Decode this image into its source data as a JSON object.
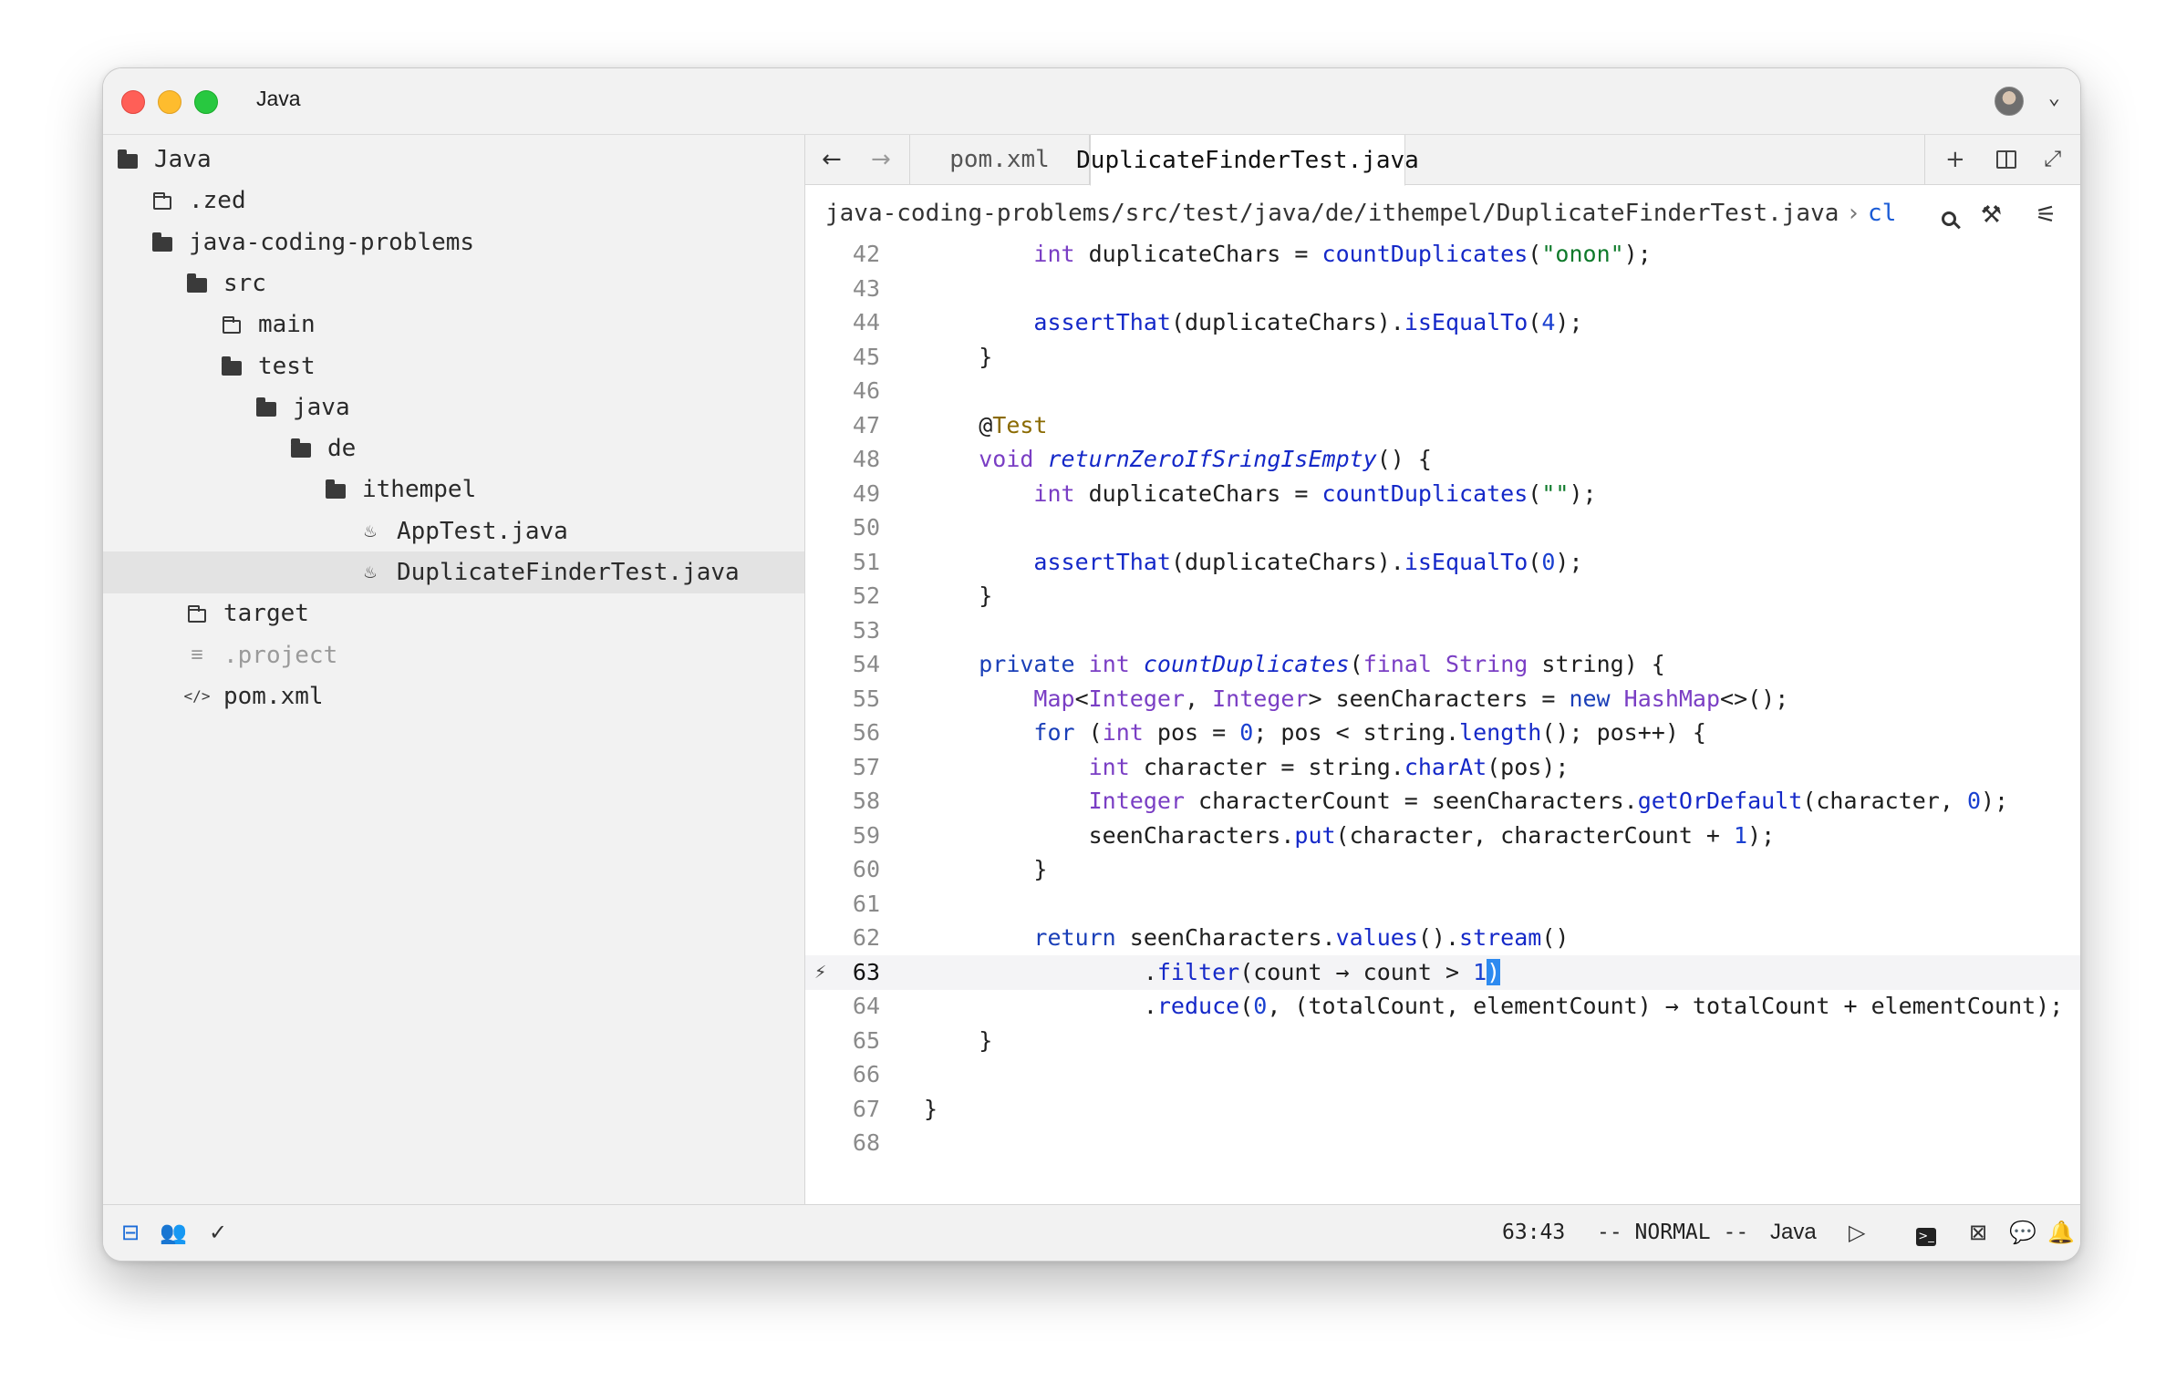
{
  "window": {
    "title": "Java"
  },
  "sidebar": {
    "items": [
      {
        "label": "Java",
        "icon": "folder-open-icon",
        "indent": 0
      },
      {
        "label": ".zed",
        "icon": "folder-icon",
        "indent": 1
      },
      {
        "label": "java-coding-problems",
        "icon": "folder-open-icon",
        "indent": 1
      },
      {
        "label": "src",
        "icon": "folder-open-icon",
        "indent": 2
      },
      {
        "label": "main",
        "icon": "folder-icon",
        "indent": 3
      },
      {
        "label": "test",
        "icon": "folder-open-icon",
        "indent": 3
      },
      {
        "label": "java",
        "icon": "folder-open-icon",
        "indent": 4
      },
      {
        "label": "de",
        "icon": "folder-open-icon",
        "indent": 5
      },
      {
        "label": "ithempel",
        "icon": "folder-open-icon",
        "indent": 6
      },
      {
        "label": "AppTest.java",
        "icon": "java-file-icon",
        "indent": 7
      },
      {
        "label": "DuplicateFinderTest.java",
        "icon": "java-file-icon",
        "indent": 7,
        "selected": true
      },
      {
        "label": "target",
        "icon": "folder-icon",
        "indent": 2
      },
      {
        "label": ".project",
        "icon": "text-file-icon",
        "indent": 2,
        "dim": true
      },
      {
        "label": "pom.xml",
        "icon": "code-file-icon",
        "indent": 2
      }
    ]
  },
  "tabs": [
    {
      "label": "pom.xml",
      "active": false
    },
    {
      "label": "DuplicateFinderTest.java",
      "active": true
    }
  ],
  "breadcrumb": {
    "path": "java-coding-problems/src/test/java/de/ithempel/DuplicateFinderTest.java",
    "separator": "›",
    "symbol": "cl"
  },
  "editor": {
    "lines": [
      {
        "n": "42",
        "tokens": [
          [
            "        ",
            ""
          ],
          [
            "int",
            "kw"
          ],
          [
            " duplicateChars = ",
            ""
          ],
          [
            "countDuplicates",
            "fn"
          ],
          [
            "(",
            ""
          ],
          [
            "\"onon\"",
            "str"
          ],
          [
            ");",
            ""
          ]
        ]
      },
      {
        "n": "43",
        "tokens": []
      },
      {
        "n": "44",
        "tokens": [
          [
            "        ",
            ""
          ],
          [
            "assertThat",
            "fn"
          ],
          [
            "(duplicateChars).",
            ""
          ],
          [
            "isEqualTo",
            "fn"
          ],
          [
            "(",
            ""
          ],
          [
            "4",
            "num"
          ],
          [
            ");",
            ""
          ]
        ]
      },
      {
        "n": "45",
        "tokens": [
          [
            "    }",
            ""
          ]
        ]
      },
      {
        "n": "46",
        "tokens": []
      },
      {
        "n": "47",
        "tokens": [
          [
            "    @",
            ""
          ],
          [
            "Test",
            "ann"
          ]
        ]
      },
      {
        "n": "48",
        "tokens": [
          [
            "    ",
            ""
          ],
          [
            "void",
            "kw"
          ],
          [
            " ",
            ""
          ],
          [
            "returnZeroIfSringIsEmpty",
            "fni"
          ],
          [
            "() {",
            ""
          ]
        ]
      },
      {
        "n": "49",
        "tokens": [
          [
            "        ",
            ""
          ],
          [
            "int",
            "kw"
          ],
          [
            " duplicateChars = ",
            ""
          ],
          [
            "countDuplicates",
            "fn"
          ],
          [
            "(",
            ""
          ],
          [
            "\"\"",
            "str"
          ],
          [
            ");",
            ""
          ]
        ]
      },
      {
        "n": "50",
        "tokens": []
      },
      {
        "n": "51",
        "tokens": [
          [
            "        ",
            ""
          ],
          [
            "assertThat",
            "fn"
          ],
          [
            "(duplicateChars).",
            ""
          ],
          [
            "isEqualTo",
            "fn"
          ],
          [
            "(",
            ""
          ],
          [
            "0",
            "num"
          ],
          [
            ");",
            ""
          ]
        ]
      },
      {
        "n": "52",
        "tokens": [
          [
            "    }",
            ""
          ]
        ]
      },
      {
        "n": "53",
        "tokens": []
      },
      {
        "n": "54",
        "tokens": [
          [
            "    ",
            ""
          ],
          [
            "private",
            "kb"
          ],
          [
            " ",
            ""
          ],
          [
            "int",
            "kw"
          ],
          [
            " ",
            ""
          ],
          [
            "countDuplicates",
            "fni"
          ],
          [
            "(",
            ""
          ],
          [
            "final",
            "kw"
          ],
          [
            " ",
            ""
          ],
          [
            "String",
            "kw"
          ],
          [
            " string) {",
            ""
          ]
        ]
      },
      {
        "n": "55",
        "tokens": [
          [
            "        ",
            ""
          ],
          [
            "Map",
            "kw"
          ],
          [
            "<",
            ""
          ],
          [
            "Integer",
            "kw"
          ],
          [
            ", ",
            ""
          ],
          [
            "Integer",
            "kw"
          ],
          [
            "> seenCharacters = ",
            ""
          ],
          [
            "new",
            "kb"
          ],
          [
            " ",
            ""
          ],
          [
            "HashMap",
            "kw"
          ],
          [
            "<>();",
            ""
          ]
        ]
      },
      {
        "n": "56",
        "tokens": [
          [
            "        ",
            ""
          ],
          [
            "for",
            "kb"
          ],
          [
            " (",
            ""
          ],
          [
            "int",
            "kw"
          ],
          [
            " pos = ",
            ""
          ],
          [
            "0",
            "num"
          ],
          [
            "; pos < string.",
            ""
          ],
          [
            "length",
            "fn"
          ],
          [
            "(); pos++) {",
            ""
          ]
        ]
      },
      {
        "n": "57",
        "tokens": [
          [
            "            ",
            ""
          ],
          [
            "int",
            "kw"
          ],
          [
            " character = string.",
            ""
          ],
          [
            "charAt",
            "fn"
          ],
          [
            "(pos);",
            ""
          ]
        ]
      },
      {
        "n": "58",
        "tokens": [
          [
            "            ",
            ""
          ],
          [
            "Integer",
            "kw"
          ],
          [
            " characterCount = seenCharacters.",
            ""
          ],
          [
            "getOrDefault",
            "fn"
          ],
          [
            "(character, ",
            ""
          ],
          [
            "0",
            "num"
          ],
          [
            ");",
            ""
          ]
        ]
      },
      {
        "n": "59",
        "tokens": [
          [
            "            seenCharacters.",
            ""
          ],
          [
            "put",
            "fn"
          ],
          [
            "(character, characterCount + ",
            ""
          ],
          [
            "1",
            "num"
          ],
          [
            ");",
            ""
          ]
        ]
      },
      {
        "n": "60",
        "tokens": [
          [
            "        }",
            ""
          ]
        ]
      },
      {
        "n": "61",
        "tokens": []
      },
      {
        "n": "62",
        "tokens": [
          [
            "        ",
            ""
          ],
          [
            "return",
            "kb"
          ],
          [
            " seenCharacters.",
            ""
          ],
          [
            "values",
            "fn"
          ],
          [
            "().",
            ""
          ],
          [
            "stream",
            "fn"
          ],
          [
            "()",
            ""
          ]
        ]
      },
      {
        "n": "63",
        "current": true,
        "mark": "⚡",
        "tokens": [
          [
            "                .",
            ""
          ],
          [
            "filter",
            "fn"
          ],
          [
            "(count → count > ",
            ""
          ],
          [
            "1",
            "num"
          ],
          [
            ")",
            "cursor"
          ]
        ]
      },
      {
        "n": "64",
        "tokens": [
          [
            "                .",
            ""
          ],
          [
            "reduce",
            "fn"
          ],
          [
            "(",
            ""
          ],
          [
            "0",
            "num"
          ],
          [
            ", (totalCount, elementCount) → totalCount + elementCount);",
            ""
          ]
        ]
      },
      {
        "n": "65",
        "tokens": [
          [
            "    }",
            ""
          ]
        ]
      },
      {
        "n": "66",
        "tokens": []
      },
      {
        "n": "67",
        "tokens": [
          [
            "}",
            ""
          ]
        ]
      },
      {
        "n": "68",
        "tokens": []
      }
    ]
  },
  "statusbar": {
    "position": "63:43",
    "mode": "-- NORMAL --",
    "language": "Java"
  },
  "colors": {
    "accent": "#2d8af0",
    "keyword": "#7a3ec4",
    "function": "#1428c8",
    "string": "#0e7a2a",
    "annotation": "#8a6a00"
  }
}
